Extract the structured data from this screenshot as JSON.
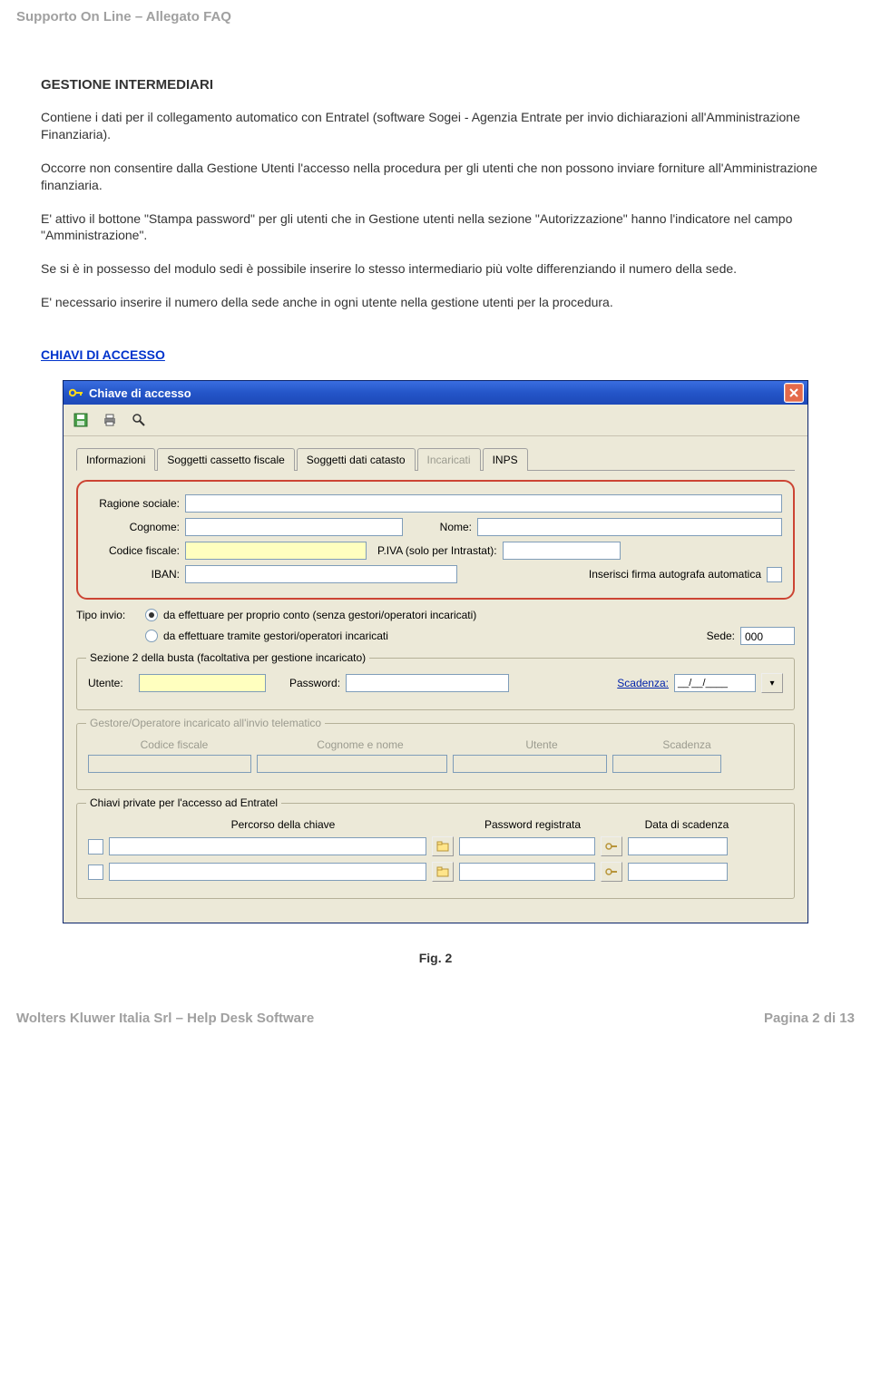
{
  "header": {
    "title": "Supporto On Line – Allegato FAQ"
  },
  "section": {
    "title": "GESTIONE INTERMEDIARI",
    "p1": "Contiene i dati per il collegamento automatico con Entratel (software Sogei - Agenzia Entrate per invio dichiarazioni all'Amministrazione Finanziaria).",
    "p2": "Occorre non consentire dalla Gestione Utenti l'accesso nella procedura per gli utenti che non possono inviare forniture all'Amministrazione finanziaria.",
    "p3": " E' attivo il bottone \"Stampa password\" per gli utenti che in Gestione utenti nella sezione \"Autorizzazione\" hanno l'indicatore nel campo \"Amministrazione\".",
    "p4": " Se si è in possesso del modulo sedi è possibile inserire lo stesso intermediario più volte differenziando il numero della sede.",
    "p5": "E' necessario inserire il numero della sede anche in ogni utente nella gestione utenti per la procedura.",
    "link": "CHIAVI DI ACCESSO"
  },
  "dialog": {
    "title": "Chiave di accesso",
    "tabs": [
      "Informazioni",
      "Soggetti cassetto fiscale",
      "Soggetti dati catasto",
      "Incaricati",
      "INPS"
    ],
    "fields": {
      "ragione_sociale_lbl": "Ragione sociale:",
      "cognome_lbl": "Cognome:",
      "nome_lbl": "Nome:",
      "codice_fiscale_lbl": "Codice fiscale:",
      "piva_lbl": "P.IVA (solo per Intrastat):",
      "iban_lbl": "IBAN:",
      "firma_lbl": "Inserisci firma autografa automatica",
      "tipo_invio_lbl": "Tipo invio:",
      "radio1": "da effettuare per proprio conto (senza gestori/operatori incaricati)",
      "radio2": "da effettuare tramite gestori/operatori incaricati",
      "sede_lbl": "Sede:",
      "sede_val": "000",
      "sezione2_lbl": "Sezione 2 della busta (facoltativa per gestione incaricato)",
      "utente_lbl": "Utente:",
      "password_lbl": "Password:",
      "scadenza_lbl": "Scadenza:",
      "scadenza_val": "__/__/____",
      "gestore_lbl": "Gestore/Operatore incaricato all'invio telematico",
      "col_cf": "Codice fiscale",
      "col_cognome": "Cognome e nome",
      "col_utente": "Utente",
      "col_scad": "Scadenza",
      "chiavi_private_lbl": "Chiavi private per l'accesso ad Entratel",
      "col_percorso": "Percorso della chiave",
      "col_pwreg": "Password registrata",
      "col_datascad": "Data di scadenza"
    }
  },
  "figure_caption": "Fig. 2",
  "footer": {
    "left": "Wolters Kluwer Italia Srl – Help Desk Software",
    "right": "Pagina 2 di 13"
  }
}
